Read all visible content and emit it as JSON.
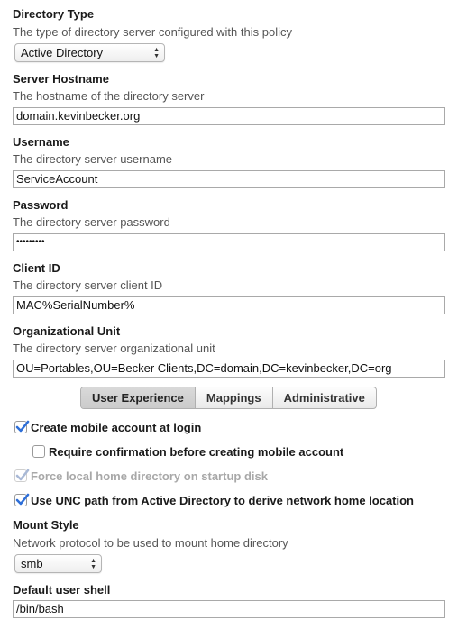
{
  "directory_type": {
    "label": "Directory Type",
    "description": "The type of directory server configured with this policy",
    "value": "Active Directory"
  },
  "server_hostname": {
    "label": "Server Hostname",
    "description": "The hostname of the directory server",
    "value": "domain.kevinbecker.org"
  },
  "username": {
    "label": "Username",
    "description": "The directory server username",
    "value": "ServiceAccount"
  },
  "password": {
    "label": "Password",
    "description": "The directory server password",
    "value": "•••••••••"
  },
  "client_id": {
    "label": "Client ID",
    "description": "The directory server client ID",
    "value": "MAC%SerialNumber%"
  },
  "org_unit": {
    "label": "Organizational Unit",
    "description": "The directory server organizational unit",
    "value": "OU=Portables,OU=Becker Clients,DC=domain,DC=kevinbecker,DC=org"
  },
  "tabs": [
    {
      "label": "User Experience",
      "active": true
    },
    {
      "label": "Mappings",
      "active": false
    },
    {
      "label": "Administrative",
      "active": false
    }
  ],
  "options": {
    "create_mobile": {
      "label": "Create mobile account at login",
      "checked": true
    },
    "require_confirmation": {
      "label": "Require confirmation before creating mobile account",
      "checked": false
    },
    "force_local_home": {
      "label": "Force local home directory on startup disk",
      "checked": true,
      "disabled": true
    },
    "use_unc": {
      "label": "Use UNC path from Active Directory to derive network home location",
      "checked": true
    }
  },
  "mount_style": {
    "label": "Mount Style",
    "description": "Network protocol to be used to mount home directory",
    "value": "smb"
  },
  "default_shell": {
    "label": "Default user shell",
    "value": "/bin/bash"
  },
  "colors": {
    "accent": "#2e6fd8"
  }
}
